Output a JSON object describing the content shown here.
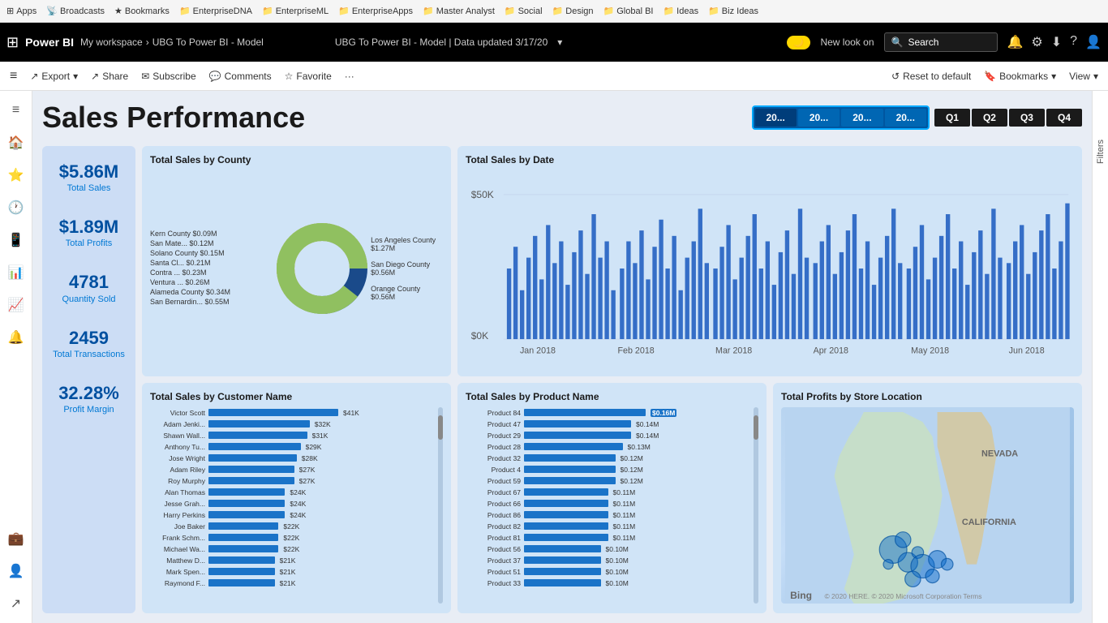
{
  "bookmarks": {
    "items": [
      {
        "label": "Apps",
        "icon": "⊞"
      },
      {
        "label": "Broadcasts",
        "icon": "📡"
      },
      {
        "label": "Bookmarks",
        "icon": "★"
      },
      {
        "label": "EnterpriseDNA",
        "icon": "📁"
      },
      {
        "label": "EnterpriseML",
        "icon": "📁"
      },
      {
        "label": "EnterpriseApps",
        "icon": "📁"
      },
      {
        "label": "Master Analyst",
        "icon": "📁"
      },
      {
        "label": "Social",
        "icon": "📁"
      },
      {
        "label": "Design",
        "icon": "📁"
      },
      {
        "label": "Global BI",
        "icon": "📁"
      },
      {
        "label": "Ideas",
        "icon": "📁"
      },
      {
        "label": "Biz Ideas",
        "icon": "📁"
      }
    ]
  },
  "header": {
    "brand": "Power BI",
    "workspace": "My workspace",
    "separator": ">",
    "report": "UBG To Power BI - Model",
    "title": "UBG To Power BI - Model  |  Data updated 3/17/20",
    "toggle_label": "New look on",
    "search_placeholder": "Search",
    "icons": [
      "🔔",
      "⚙",
      "⬇",
      "?",
      "☺"
    ]
  },
  "toolbar": {
    "buttons": [
      {
        "label": "Export",
        "icon": "↗"
      },
      {
        "label": "Share",
        "icon": "↗"
      },
      {
        "label": "Subscribe",
        "icon": "✉"
      },
      {
        "label": "Comments",
        "icon": "💬"
      },
      {
        "label": "Favorite",
        "icon": "★"
      },
      {
        "label": "...",
        "icon": ""
      }
    ],
    "right_buttons": [
      {
        "label": "Reset to default",
        "icon": "↺"
      },
      {
        "label": "Bookmarks",
        "icon": "🔖"
      },
      {
        "label": "View",
        "icon": ""
      }
    ]
  },
  "sidebar": {
    "icons": [
      "≡",
      "🏠",
      "⭐",
      "🕐",
      "💬",
      "📊",
      "🔔",
      "👤"
    ]
  },
  "dashboard": {
    "title": "Sales Performance",
    "year_filters": [
      {
        "label": "20...",
        "active": true
      },
      {
        "label": "20...",
        "active": false
      },
      {
        "label": "20...",
        "active": false
      },
      {
        "label": "20...",
        "active": false
      }
    ],
    "quarter_filters": [
      {
        "label": "Q1"
      },
      {
        "label": "Q2"
      },
      {
        "label": "Q3"
      },
      {
        "label": "Q4"
      }
    ],
    "kpis": [
      {
        "value": "$5.86M",
        "label": "Total Sales"
      },
      {
        "value": "$1.89M",
        "label": "Total Profits"
      },
      {
        "value": "4781",
        "label": "Quantity Sold"
      },
      {
        "value": "2459",
        "label": "Total Transactions"
      },
      {
        "value": "32.28%",
        "label": "Profit Margin"
      }
    ],
    "charts": {
      "county_donut": {
        "title": "Total Sales by County",
        "legend": [
          {
            "label": "Kern County $0.09M"
          },
          {
            "label": "San Mate... $0.12M"
          },
          {
            "label": "Solano County $0.15M"
          },
          {
            "label": "Santa Cl... $0.21M"
          },
          {
            "label": "Contra ... $0.23M"
          },
          {
            "label": "Ventura ... $0.26M"
          },
          {
            "label": "Alameda County $0.34M"
          },
          {
            "label": "San Bernardin... $0.55M"
          },
          {
            "label": "Orange County $0.56M"
          },
          {
            "label": "San Diego County $0.56M"
          },
          {
            "label": "Los Angeles County $1.27M"
          }
        ]
      },
      "date_chart": {
        "title": "Total Sales by Date",
        "y_labels": [
          "$50K",
          "$0K"
        ],
        "x_labels": [
          "Jan 2018",
          "Feb 2018",
          "Mar 2018",
          "Apr 2018",
          "May 2018",
          "Jun 2018"
        ]
      },
      "customer_chart": {
        "title": "Total Sales by Customer Name",
        "rows": [
          {
            "name": "Victor Scott",
            "value": "$41K",
            "pct": 100
          },
          {
            "name": "Adam Jenki...",
            "value": "$32K",
            "pct": 78
          },
          {
            "name": "Shawn Wall...",
            "value": "$31K",
            "pct": 76
          },
          {
            "name": "Anthony Tu...",
            "value": "$29K",
            "pct": 71
          },
          {
            "name": "Jose Wright",
            "value": "$28K",
            "pct": 68
          },
          {
            "name": "Adam Riley",
            "value": "$27K",
            "pct": 66
          },
          {
            "name": "Roy Murphy",
            "value": "$27K",
            "pct": 66
          },
          {
            "name": "Alan Thomas",
            "value": "$24K",
            "pct": 59
          },
          {
            "name": "Jesse Grah...",
            "value": "$24K",
            "pct": 59
          },
          {
            "name": "Harry Perkins",
            "value": "$24K",
            "pct": 59
          },
          {
            "name": "Joe Baker",
            "value": "$22K",
            "pct": 54
          },
          {
            "name": "Frank Schm...",
            "value": "$22K",
            "pct": 54
          },
          {
            "name": "Michael Wa...",
            "value": "$22K",
            "pct": 54
          },
          {
            "name": "Matthew D...",
            "value": "$21K",
            "pct": 51
          },
          {
            "name": "Mark Spen...",
            "value": "$21K",
            "pct": 51
          },
          {
            "name": "Raymond F...",
            "value": "$21K",
            "pct": 51
          }
        ]
      },
      "product_chart": {
        "title": "Total Sales by Product Name",
        "rows": [
          {
            "name": "Product 84",
            "value": "$0.16M",
            "pct": 100,
            "highlight": true
          },
          {
            "name": "Product 47",
            "value": "$0.14M",
            "pct": 88
          },
          {
            "name": "Product 29",
            "value": "$0.14M",
            "pct": 88
          },
          {
            "name": "Product 28",
            "value": "$0.13M",
            "pct": 81
          },
          {
            "name": "Product 32",
            "value": "$0.12M",
            "pct": 75
          },
          {
            "name": "Product 4",
            "value": "$0.12M",
            "pct": 75
          },
          {
            "name": "Product 59",
            "value": "$0.12M",
            "pct": 75
          },
          {
            "name": "Product 67",
            "value": "$0.11M",
            "pct": 69
          },
          {
            "name": "Product 66",
            "value": "$0.11M",
            "pct": 69
          },
          {
            "name": "Product 86",
            "value": "$0.11M",
            "pct": 69
          },
          {
            "name": "Product 82",
            "value": "$0.11M",
            "pct": 69
          },
          {
            "name": "Product 81",
            "value": "$0.11M",
            "pct": 69
          },
          {
            "name": "Product 56",
            "value": "$0.10M",
            "pct": 63
          },
          {
            "name": "Product 37",
            "value": "$0.10M",
            "pct": 63
          },
          {
            "name": "Product 51",
            "value": "$0.10M",
            "pct": 63
          },
          {
            "name": "Product 33",
            "value": "$0.10M",
            "pct": 63
          }
        ]
      },
      "map": {
        "title": "Total Profits by Store Location",
        "bing_label": "Bing",
        "copyright": "© 2020 HERE. © 2020 Microsoft Corporation  Terms"
      }
    }
  },
  "filters": {
    "label": "Filters"
  }
}
